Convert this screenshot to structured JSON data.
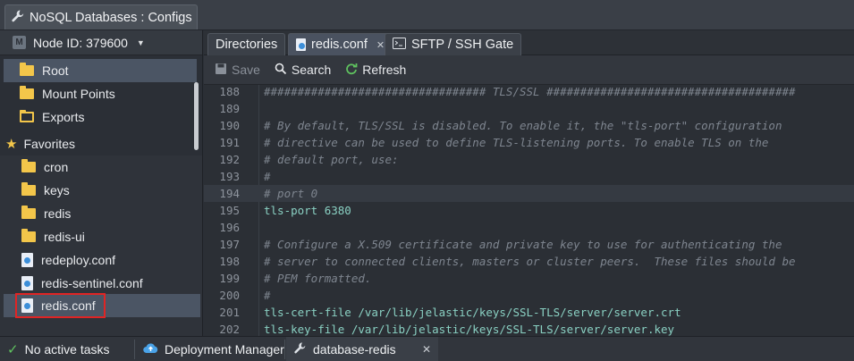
{
  "window": {
    "title": "NoSQL Databases : Configs",
    "icon": "wrench-icon"
  },
  "left_panel": {
    "node_label": "Node ID: 379600",
    "tree": [
      {
        "label": "Root",
        "icon": "folder-icon",
        "selected": true
      },
      {
        "label": "Mount Points",
        "icon": "folder-icon",
        "selected": false
      },
      {
        "label": "Exports",
        "icon": "exports-folder-icon",
        "selected": false
      }
    ],
    "favorites_label": "Favorites",
    "favorites": [
      {
        "label": "cron",
        "icon": "folder-icon"
      },
      {
        "label": "keys",
        "icon": "folder-icon"
      },
      {
        "label": "redis",
        "icon": "folder-icon"
      },
      {
        "label": "redis-ui",
        "icon": "folder-icon"
      },
      {
        "label": "redeploy.conf",
        "icon": "config-file-icon"
      },
      {
        "label": "redis-sentinel.conf",
        "icon": "config-file-icon"
      },
      {
        "label": "redis.conf",
        "icon": "config-file-icon",
        "active": true
      }
    ]
  },
  "tabs": [
    {
      "label": "Directories"
    },
    {
      "label": "redis.conf",
      "active": true
    },
    {
      "label": "SFTP / SSH Gate"
    }
  ],
  "toolbar": {
    "save_label": "Save",
    "search_label": "Search",
    "refresh_label": "Refresh"
  },
  "editor": {
    "lines": [
      {
        "n": "188",
        "text": "################################# TLS/SSL #####################################",
        "kind": "comment"
      },
      {
        "n": "189",
        "text": "",
        "kind": "comment"
      },
      {
        "n": "190",
        "text": "# By default, TLS/SSL is disabled. To enable it, the \"tls-port\" configuration",
        "kind": "comment"
      },
      {
        "n": "191",
        "text": "# directive can be used to define TLS-listening ports. To enable TLS on the",
        "kind": "comment"
      },
      {
        "n": "192",
        "text": "# default port, use:",
        "kind": "comment"
      },
      {
        "n": "193",
        "text": "#",
        "kind": "comment"
      },
      {
        "n": "194",
        "text": "# port 0",
        "kind": "comment",
        "current": true
      },
      {
        "n": "195",
        "text": "tls-port 6380",
        "kind": "plain"
      },
      {
        "n": "196",
        "text": "",
        "kind": "comment"
      },
      {
        "n": "197",
        "text": "# Configure a X.509 certificate and private key to use for authenticating the",
        "kind": "comment"
      },
      {
        "n": "198",
        "text": "# server to connected clients, masters or cluster peers.  These files should be",
        "kind": "comment"
      },
      {
        "n": "199",
        "text": "# PEM formatted.",
        "kind": "comment"
      },
      {
        "n": "200",
        "text": "#",
        "kind": "comment"
      },
      {
        "n": "201",
        "text": "tls-cert-file /var/lib/jelastic/keys/SSL-TLS/server/server.crt",
        "kind": "plain"
      },
      {
        "n": "202",
        "text": "tls-key-file /var/lib/jelastic/keys/SSL-TLS/server/server.key",
        "kind": "plain"
      }
    ]
  },
  "statusbar": {
    "tasks_label": "No active tasks",
    "deployment_label": "Deployment Manager",
    "env_label": "database-redis"
  },
  "colors": {
    "accent_folder": "#f3c64a",
    "selection": "#4b5564",
    "highlight_border": "#e02424",
    "code_plain": "#8ad1c3"
  }
}
